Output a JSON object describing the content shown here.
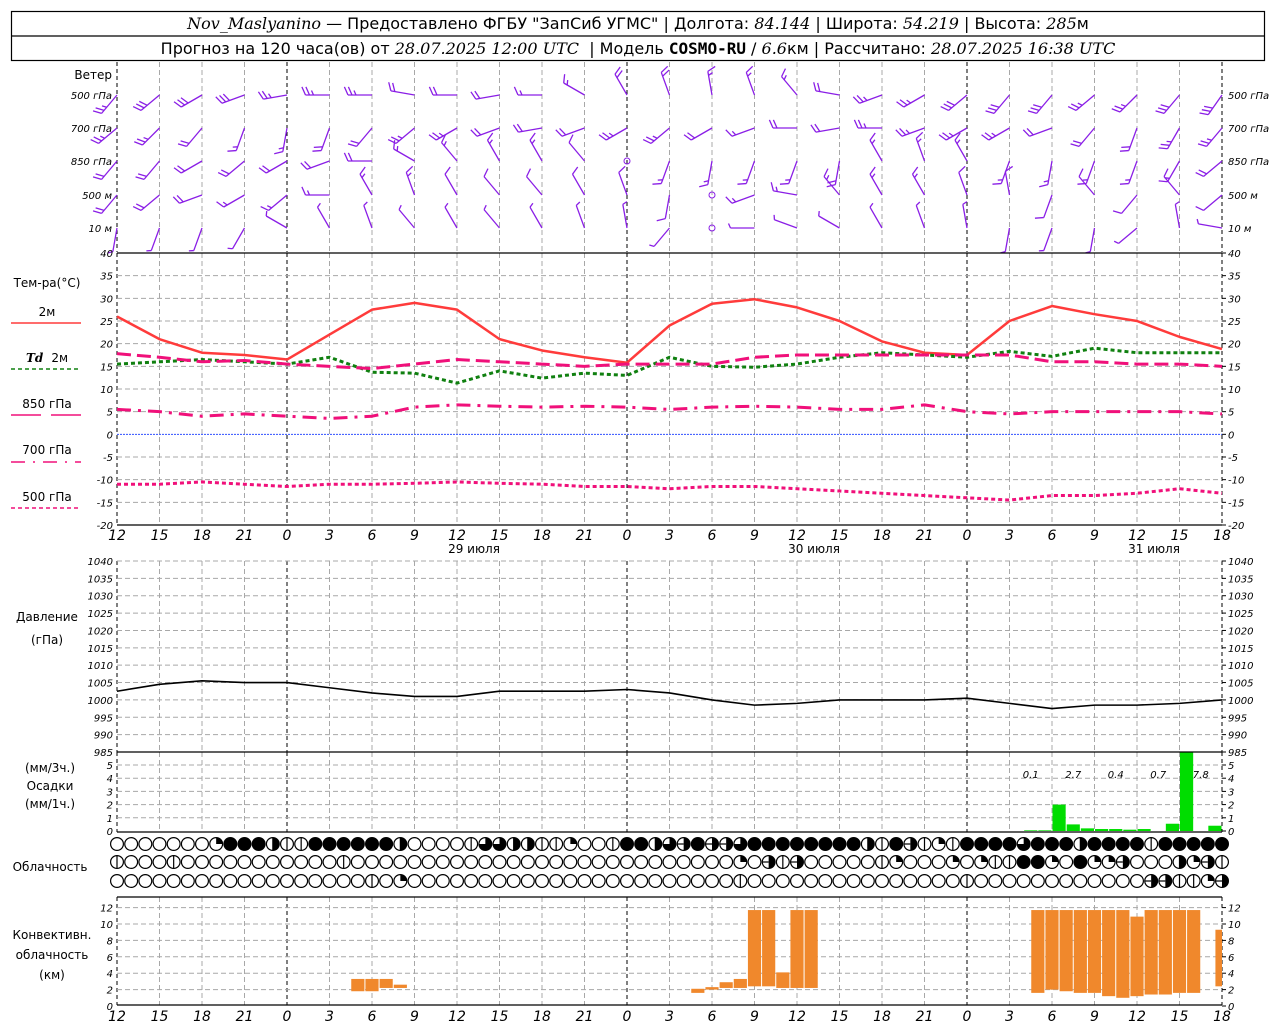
{
  "header": {
    "station": "Nov_Maslyanino",
    "provider": " — Предоставлено ФГБУ \"ЗапСиб УГМС\" | Долгота: ",
    "longitude": "84.144",
    "lat_label": " | Широта: ",
    "latitude": "54.219",
    "alt_label": " | Высота: ",
    "altitude": "285",
    "alt_unit": "м",
    "forecast_label": "Прогноз на 120 часа(ов) от ",
    "forecast_start": "28.07.2025 12:00 UTC",
    "model_label": "  | Модель ",
    "model": "COSMO-RU",
    "res_sep": " / ",
    "resolution": "6.6",
    "res_unit": "км",
    "calc_label": " | Рассчитано: ",
    "calculated": "28.07.2025 16:38 UTC"
  },
  "labels": {
    "wind": "Ветер",
    "wind_levels": [
      "500 гПа",
      "700 гПа",
      "850 гПа",
      "500 м",
      "10 м"
    ],
    "temperature": "Тем-ра(°C)",
    "t2m": "2м",
    "td_prefix": "Td",
    "td2m": "2м",
    "t850": "850 гПа",
    "t700": "700 гПа",
    "t500": "500 гПа",
    "pressure": "Давление",
    "pressure_unit": "(гПа)",
    "precip_unit3": "(мм/3ч.)",
    "precip": "Осадки",
    "precip_unit1": "(мм/1ч.)",
    "cloud": "Облачность",
    "conv1": "Конвективн.",
    "conv2": "облачность",
    "conv3": "(км)"
  },
  "time_axis": {
    "start": "28.07 12",
    "hours_total": 78,
    "tick_labels": [
      "12",
      "15",
      "18",
      "21",
      "0",
      "3",
      "6",
      "9",
      "12",
      "15",
      "18",
      "21",
      "0",
      "3",
      "6",
      "9",
      "12",
      "15",
      "18",
      "21",
      "0",
      "3",
      "6",
      "9",
      "12",
      "15",
      "18"
    ],
    "dates": [
      "29 июля",
      "30 июля",
      "31 июля"
    ]
  },
  "colors": {
    "t2m": "#ff3b3b",
    "td2m": "#108010",
    "upper": "#f0107a",
    "zero": "#3050ff",
    "pressure": "#000000",
    "precip": "#00dd00",
    "convective": "#f0882c",
    "wind": "#8a1ee6"
  },
  "wind": {
    "step_hours": 3,
    "unit": "m/s",
    "levels": [
      {
        "name": "500 гПа",
        "dir": [
          220,
          230,
          240,
          250,
          260,
          270,
          270,
          280,
          270,
          260,
          270,
          300,
          330,
          340,
          350,
          340,
          320,
          280,
          250,
          240,
          230,
          220,
          220,
          230,
          225,
          220,
          215
        ],
        "speed": [
          10,
          12,
          12,
          12,
          10,
          10,
          10,
          8,
          8,
          8,
          6,
          6,
          8,
          8,
          6,
          6,
          6,
          8,
          10,
          10,
          12,
          12,
          12,
          10,
          10,
          12,
          12
        ]
      },
      {
        "name": "700 гПа",
        "dir": [
          230,
          225,
          220,
          200,
          190,
          200,
          220,
          230,
          240,
          250,
          260,
          250,
          240,
          230,
          240,
          250,
          270,
          260,
          270,
          250,
          240,
          240,
          250,
          220,
          200,
          210,
          220
        ],
        "speed": [
          10,
          10,
          8,
          6,
          6,
          8,
          8,
          10,
          10,
          8,
          8,
          8,
          10,
          10,
          8,
          6,
          8,
          8,
          10,
          10,
          10,
          10,
          8,
          8,
          8,
          10,
          10
        ]
      },
      {
        "name": "850 гПа",
        "dir": [
          220,
          220,
          240,
          230,
          240,
          250,
          270,
          300,
          320,
          330,
          330,
          320,
          0,
          200,
          190,
          200,
          200,
          190,
          330,
          340,
          330,
          200,
          190,
          200,
          200,
          210,
          230
        ],
        "speed": [
          8,
          8,
          8,
          8,
          8,
          8,
          8,
          6,
          6,
          6,
          6,
          4,
          0,
          6,
          6,
          6,
          6,
          8,
          6,
          6,
          6,
          6,
          6,
          6,
          6,
          6,
          8
        ]
      },
      {
        "name": "500 м",
        "dir": [
          220,
          230,
          250,
          240,
          230,
          270,
          330,
          340,
          330,
          320,
          320,
          330,
          340,
          190,
          200,
          250,
          280,
          320,
          330,
          330,
          340,
          350,
          200,
          320,
          220,
          320,
          230
        ],
        "speed": [
          8,
          8,
          8,
          6,
          6,
          6,
          6,
          6,
          4,
          4,
          4,
          4,
          4,
          4,
          0,
          6,
          6,
          6,
          6,
          6,
          4,
          4,
          4,
          4,
          4,
          4,
          4
        ]
      },
      {
        "name": "10 м",
        "dir": [
          190,
          200,
          200,
          210,
          300,
          330,
          340,
          320,
          330,
          320,
          330,
          340,
          350,
          220,
          230,
          270,
          290,
          300,
          330,
          340,
          350,
          190,
          200,
          190,
          230,
          350,
          280
        ],
        "speed": [
          2,
          2,
          2,
          2,
          2,
          2,
          2,
          2,
          2,
          2,
          2,
          2,
          2,
          2,
          0,
          2,
          2,
          2,
          2,
          2,
          2,
          2,
          2,
          2,
          2,
          2,
          2
        ]
      }
    ]
  },
  "chart_data": [
    {
      "type": "line",
      "panel": "temperature",
      "ylabel": "Тем-ра(°C)",
      "ylim": [
        -20,
        40
      ],
      "yticks": [
        -20,
        -15,
        -10,
        -5,
        0,
        5,
        10,
        15,
        20,
        25,
        30,
        35,
        40
      ],
      "grid": true,
      "x_start": "28.07 12",
      "x_step_hours": 3,
      "series": [
        {
          "name": "2м",
          "style": "solid",
          "values": [
            26,
            21,
            18,
            17.5,
            16.5,
            22,
            27.5,
            29,
            27.5,
            21,
            18.5,
            17,
            15.8,
            24,
            28.8,
            29.8,
            28,
            25,
            20.5,
            18,
            17.5,
            25,
            28.3,
            26.5,
            25,
            21.5,
            18.8
          ]
        },
        {
          "name": "Td 2м",
          "style": "dotted",
          "values": [
            15.5,
            16,
            16.5,
            16,
            15.5,
            17,
            13.7,
            13.5,
            11.3,
            14,
            12.4,
            13.5,
            13,
            17,
            15,
            14.8,
            15.5,
            17,
            18,
            17.5,
            17,
            18.3,
            17.2,
            19,
            18,
            18,
            18
          ]
        },
        {
          "name": "850 гПа",
          "style": "dashed",
          "values": [
            17.8,
            17,
            16,
            16.3,
            15.5,
            15,
            14.5,
            15.5,
            16.5,
            16,
            15.5,
            15,
            15.5,
            15.5,
            15.5,
            17,
            17.5,
            17.5,
            17.5,
            17.5,
            17.5,
            17.5,
            16,
            16,
            15.5,
            15.5,
            15
          ]
        },
        {
          "name": "700 гПа",
          "style": "dashdot",
          "values": [
            5.5,
            5,
            4,
            4.5,
            4,
            3.5,
            4,
            6,
            6.5,
            6.2,
            6,
            6.2,
            6,
            5.5,
            6,
            6.2,
            6,
            5.5,
            5.5,
            6.5,
            5,
            4.5,
            5,
            5,
            5,
            5,
            4.5
          ]
        },
        {
          "name": "500 гПа",
          "style": "dotted",
          "values": [
            -11,
            -11,
            -10.5,
            -11,
            -11.5,
            -11,
            -11,
            -10.8,
            -10.5,
            -10.8,
            -11,
            -11.5,
            -11.5,
            -12,
            -11.5,
            -11.5,
            -12,
            -12.5,
            -13,
            -13.5,
            -14,
            -14.5,
            -13.5,
            -13.5,
            -13,
            -12,
            -13
          ]
        }
      ]
    },
    {
      "type": "line",
      "panel": "pressure",
      "ylabel": "Давление (гПа)",
      "ylim": [
        985,
        1040
      ],
      "yticks": [
        985,
        990,
        995,
        1000,
        1005,
        1010,
        1015,
        1020,
        1025,
        1030,
        1035,
        1040
      ],
      "grid": true,
      "x_start": "28.07 12",
      "x_step_hours": 3,
      "series": [
        {
          "values": [
            1002.5,
            1004.5,
            1005.5,
            1005,
            1005,
            1003.5,
            1002,
            1001,
            1001,
            1002.5,
            1002.5,
            1002.5,
            1003,
            1002,
            1000,
            998.5,
            999,
            1000,
            1000,
            1000,
            1000.5,
            999,
            997.5,
            998.5,
            998.5,
            999,
            1000
          ]
        }
      ]
    },
    {
      "type": "bar",
      "panel": "precipitation",
      "ylabel": "Осадки",
      "ylim": [
        0,
        5.5
      ],
      "yticks": [
        0,
        1,
        2,
        3,
        4,
        5
      ],
      "hourly": {
        "first_end": "31.07 05",
        "values": [
          0.05,
          0.05,
          2.0,
          0.5,
          0.2,
          0.15,
          0.15,
          0.1,
          0.15,
          0,
          0.55,
          7.4,
          0,
          0.4
        ]
      },
      "sums_3h": [
        {
          "end": "31.07 06",
          "text": "0.1"
        },
        {
          "end": "31.07 09",
          "text": "2.7"
        },
        {
          "end": "31.07 12",
          "text": "0.4"
        },
        {
          "end": "31.07 15",
          "text": "0.7"
        },
        {
          "end": "31.07 18",
          "text": "7.8"
        }
      ]
    },
    {
      "type": "table",
      "panel": "cloudiness",
      "x_start": "28.07 12",
      "x_step_hours": 1,
      "legend": {
        "0": "clear",
        "1": "trace",
        "2": "quarter",
        "4": "half",
        "5": "half-layered",
        "6": "three-quarter",
        "8": "overcast"
      },
      "rows": [
        "0000000288841188888840000166441120018846585568888888841851218888688848888188888",
        "1000100000000000100000000000000000000000000020515000001200020211882082250004251",
        "0000000000000000001020000000000000000000000010000000000000001000000000000551125106"
      ]
    },
    {
      "type": "bar",
      "panel": "convective",
      "ylabel": "Конвективн. облачность (км)",
      "ylim": [
        0,
        13
      ],
      "yticks": [
        0,
        2,
        4,
        6,
        8,
        10,
        12
      ],
      "bars": [
        {
          "t": "29.07 05",
          "base": 1.8,
          "top": 3.3
        },
        {
          "t": "29.07 06",
          "base": 1.8,
          "top": 3.3
        },
        {
          "t": "29.07 07",
          "base": 2.2,
          "top": 3.3
        },
        {
          "t": "29.07 08",
          "base": 2.2,
          "top": 2.6
        },
        {
          "t": "30.07 05",
          "base": 1.6,
          "top": 2.1
        },
        {
          "t": "30.07 06",
          "base": 2.0,
          "top": 2.3
        },
        {
          "t": "30.07 07",
          "base": 2.2,
          "top": 2.9
        },
        {
          "t": "30.07 08",
          "base": 2.2,
          "top": 3.3
        },
        {
          "t": "30.07 09",
          "base": 2.4,
          "top": 11.7
        },
        {
          "t": "30.07 10",
          "base": 2.4,
          "top": 11.7
        },
        {
          "t": "30.07 11",
          "base": 2.2,
          "top": 4.1
        },
        {
          "t": "30.07 12",
          "base": 2.2,
          "top": 11.7
        },
        {
          "t": "30.07 13",
          "base": 2.2,
          "top": 11.7
        },
        {
          "t": "31.07 05",
          "base": 1.6,
          "top": 11.7
        },
        {
          "t": "31.07 06",
          "base": 2.0,
          "top": 11.7
        },
        {
          "t": "31.07 07",
          "base": 1.8,
          "top": 11.7
        },
        {
          "t": "31.07 08",
          "base": 1.6,
          "top": 11.7
        },
        {
          "t": "31.07 09",
          "base": 1.6,
          "top": 11.7
        },
        {
          "t": "31.07 10",
          "base": 1.2,
          "top": 11.7
        },
        {
          "t": "31.07 11",
          "base": 1.0,
          "top": 11.7
        },
        {
          "t": "31.07 12",
          "base": 1.2,
          "top": 10.9
        },
        {
          "t": "31.07 13",
          "base": 1.4,
          "top": 11.7
        },
        {
          "t": "31.07 14",
          "base": 1.4,
          "top": 11.7
        },
        {
          "t": "31.07 15",
          "base": 1.6,
          "top": 11.7
        },
        {
          "t": "31.07 16",
          "base": 1.6,
          "top": 11.7
        },
        {
          "t": "31.07 18",
          "base": 2.4,
          "top": 9.3
        }
      ]
    }
  ]
}
